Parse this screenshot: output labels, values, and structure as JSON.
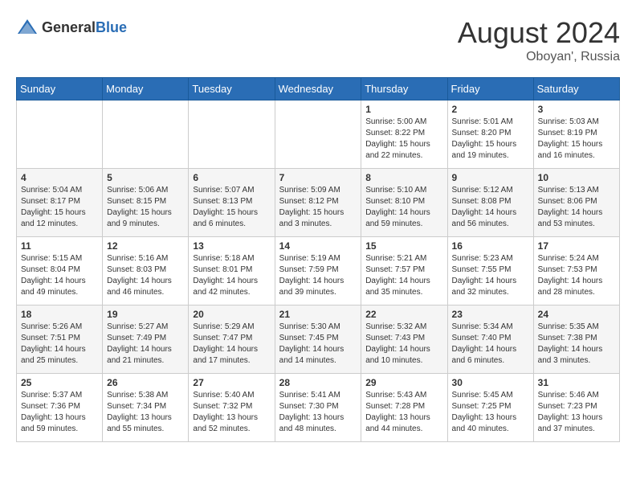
{
  "header": {
    "logo_general": "General",
    "logo_blue": "Blue",
    "month_year": "August 2024",
    "location": "Oboyan', Russia"
  },
  "weekdays": [
    "Sunday",
    "Monday",
    "Tuesday",
    "Wednesday",
    "Thursday",
    "Friday",
    "Saturday"
  ],
  "rows": [
    [
      {
        "day": "",
        "info": ""
      },
      {
        "day": "",
        "info": ""
      },
      {
        "day": "",
        "info": ""
      },
      {
        "day": "",
        "info": ""
      },
      {
        "day": "1",
        "info": "Sunrise: 5:00 AM\nSunset: 8:22 PM\nDaylight: 15 hours\nand 22 minutes."
      },
      {
        "day": "2",
        "info": "Sunrise: 5:01 AM\nSunset: 8:20 PM\nDaylight: 15 hours\nand 19 minutes."
      },
      {
        "day": "3",
        "info": "Sunrise: 5:03 AM\nSunset: 8:19 PM\nDaylight: 15 hours\nand 16 minutes."
      }
    ],
    [
      {
        "day": "4",
        "info": "Sunrise: 5:04 AM\nSunset: 8:17 PM\nDaylight: 15 hours\nand 12 minutes."
      },
      {
        "day": "5",
        "info": "Sunrise: 5:06 AM\nSunset: 8:15 PM\nDaylight: 15 hours\nand 9 minutes."
      },
      {
        "day": "6",
        "info": "Sunrise: 5:07 AM\nSunset: 8:13 PM\nDaylight: 15 hours\nand 6 minutes."
      },
      {
        "day": "7",
        "info": "Sunrise: 5:09 AM\nSunset: 8:12 PM\nDaylight: 15 hours\nand 3 minutes."
      },
      {
        "day": "8",
        "info": "Sunrise: 5:10 AM\nSunset: 8:10 PM\nDaylight: 14 hours\nand 59 minutes."
      },
      {
        "day": "9",
        "info": "Sunrise: 5:12 AM\nSunset: 8:08 PM\nDaylight: 14 hours\nand 56 minutes."
      },
      {
        "day": "10",
        "info": "Sunrise: 5:13 AM\nSunset: 8:06 PM\nDaylight: 14 hours\nand 53 minutes."
      }
    ],
    [
      {
        "day": "11",
        "info": "Sunrise: 5:15 AM\nSunset: 8:04 PM\nDaylight: 14 hours\nand 49 minutes."
      },
      {
        "day": "12",
        "info": "Sunrise: 5:16 AM\nSunset: 8:03 PM\nDaylight: 14 hours\nand 46 minutes."
      },
      {
        "day": "13",
        "info": "Sunrise: 5:18 AM\nSunset: 8:01 PM\nDaylight: 14 hours\nand 42 minutes."
      },
      {
        "day": "14",
        "info": "Sunrise: 5:19 AM\nSunset: 7:59 PM\nDaylight: 14 hours\nand 39 minutes."
      },
      {
        "day": "15",
        "info": "Sunrise: 5:21 AM\nSunset: 7:57 PM\nDaylight: 14 hours\nand 35 minutes."
      },
      {
        "day": "16",
        "info": "Sunrise: 5:23 AM\nSunset: 7:55 PM\nDaylight: 14 hours\nand 32 minutes."
      },
      {
        "day": "17",
        "info": "Sunrise: 5:24 AM\nSunset: 7:53 PM\nDaylight: 14 hours\nand 28 minutes."
      }
    ],
    [
      {
        "day": "18",
        "info": "Sunrise: 5:26 AM\nSunset: 7:51 PM\nDaylight: 14 hours\nand 25 minutes."
      },
      {
        "day": "19",
        "info": "Sunrise: 5:27 AM\nSunset: 7:49 PM\nDaylight: 14 hours\nand 21 minutes."
      },
      {
        "day": "20",
        "info": "Sunrise: 5:29 AM\nSunset: 7:47 PM\nDaylight: 14 hours\nand 17 minutes."
      },
      {
        "day": "21",
        "info": "Sunrise: 5:30 AM\nSunset: 7:45 PM\nDaylight: 14 hours\nand 14 minutes."
      },
      {
        "day": "22",
        "info": "Sunrise: 5:32 AM\nSunset: 7:43 PM\nDaylight: 14 hours\nand 10 minutes."
      },
      {
        "day": "23",
        "info": "Sunrise: 5:34 AM\nSunset: 7:40 PM\nDaylight: 14 hours\nand 6 minutes."
      },
      {
        "day": "24",
        "info": "Sunrise: 5:35 AM\nSunset: 7:38 PM\nDaylight: 14 hours\nand 3 minutes."
      }
    ],
    [
      {
        "day": "25",
        "info": "Sunrise: 5:37 AM\nSunset: 7:36 PM\nDaylight: 13 hours\nand 59 minutes."
      },
      {
        "day": "26",
        "info": "Sunrise: 5:38 AM\nSunset: 7:34 PM\nDaylight: 13 hours\nand 55 minutes."
      },
      {
        "day": "27",
        "info": "Sunrise: 5:40 AM\nSunset: 7:32 PM\nDaylight: 13 hours\nand 52 minutes."
      },
      {
        "day": "28",
        "info": "Sunrise: 5:41 AM\nSunset: 7:30 PM\nDaylight: 13 hours\nand 48 minutes."
      },
      {
        "day": "29",
        "info": "Sunrise: 5:43 AM\nSunset: 7:28 PM\nDaylight: 13 hours\nand 44 minutes."
      },
      {
        "day": "30",
        "info": "Sunrise: 5:45 AM\nSunset: 7:25 PM\nDaylight: 13 hours\nand 40 minutes."
      },
      {
        "day": "31",
        "info": "Sunrise: 5:46 AM\nSunset: 7:23 PM\nDaylight: 13 hours\nand 37 minutes."
      }
    ]
  ]
}
